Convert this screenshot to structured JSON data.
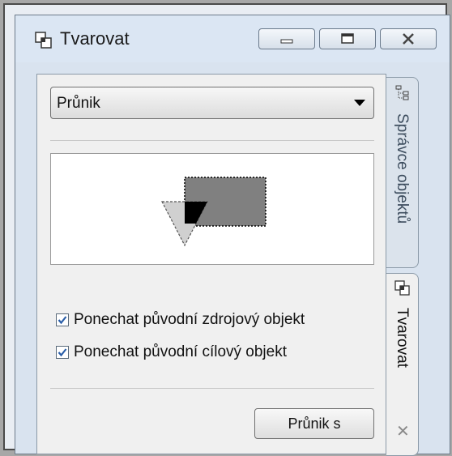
{
  "window": {
    "title": "Tvarovat",
    "icon": "shaping-icon",
    "controls": [
      "minimize-icon",
      "maximize-icon",
      "close-icon"
    ]
  },
  "panel": {
    "operation_select": {
      "value": "Průnik"
    },
    "preview": {
      "description_icons": [
        "triangle-source",
        "rectangle-target",
        "intersection"
      ]
    },
    "checkboxes": [
      {
        "label": "Ponechat původní zdrojový objekt",
        "checked": true
      },
      {
        "label": "Ponechat původní cílový objekt",
        "checked": true
      }
    ],
    "action_button": {
      "label": "Průnik s"
    }
  },
  "side_tabs": [
    {
      "label": "Správce objektů",
      "icon": "object-manager-icon",
      "active": false
    },
    {
      "label": "Tvarovat",
      "icon": "shaping-icon",
      "active": true,
      "close_icon": "close-icon"
    }
  ],
  "colors": {
    "accent_check": "#2a5ea8",
    "title_bar": "#dbe6f3",
    "panel": "#f0f0f0",
    "shape_rect": "#808080",
    "shape_triangle": "#c8c8c8",
    "shape_intersection": "#000000"
  }
}
